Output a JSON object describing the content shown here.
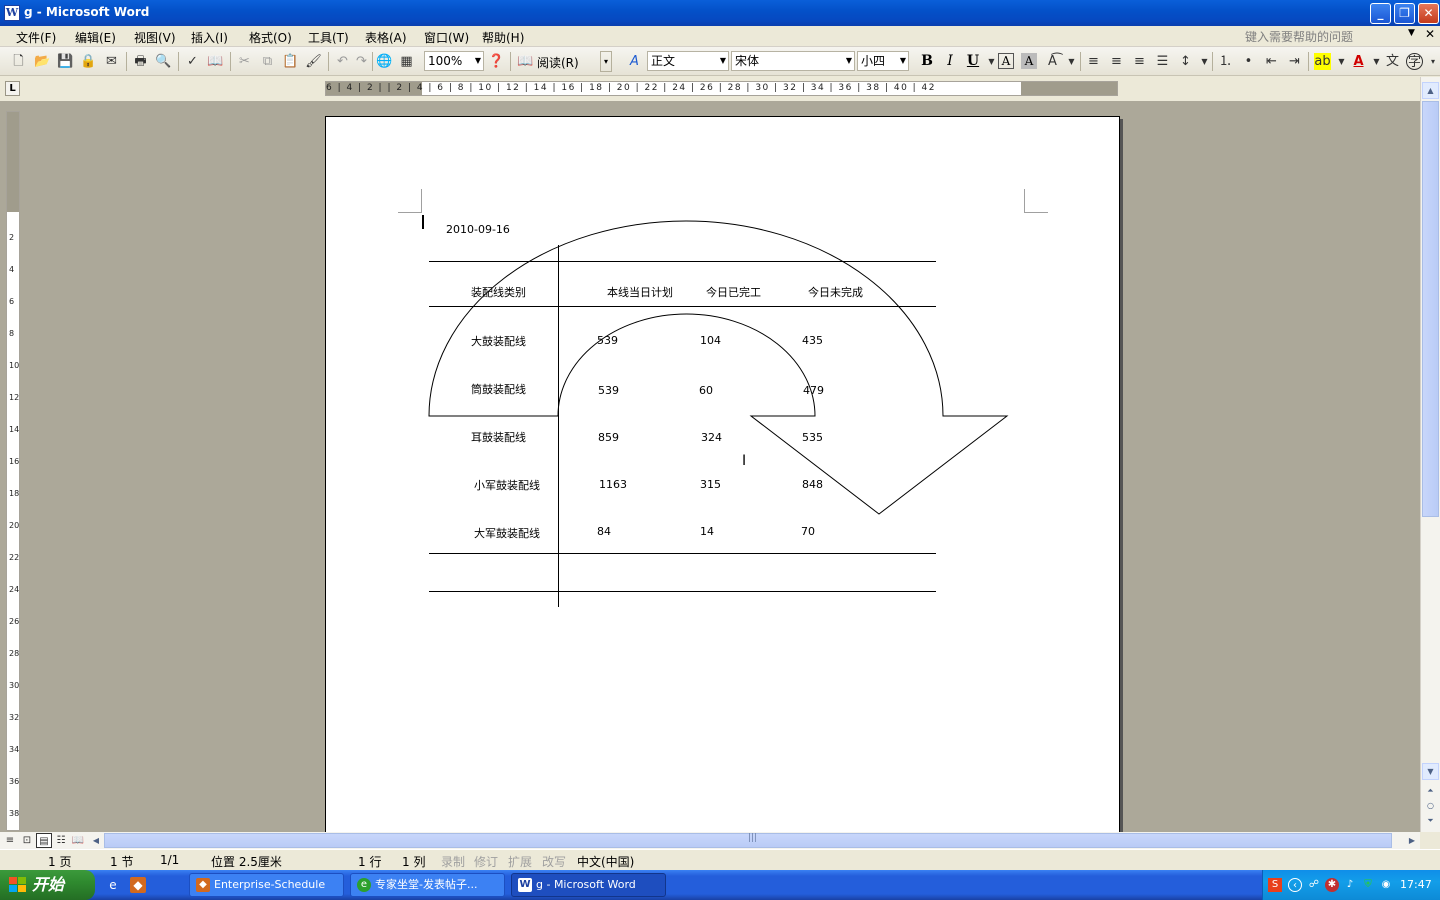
{
  "window": {
    "title": "g - Microsoft Word",
    "app_icon": "W"
  },
  "menu": {
    "items": [
      "文件(F)",
      "编辑(E)",
      "视图(V)",
      "插入(I)",
      "格式(O)",
      "工具(T)",
      "表格(A)",
      "窗口(W)",
      "帮助(H)"
    ],
    "help_placeholder": "键入需要帮助的问题"
  },
  "toolbar": {
    "zoom": "100%",
    "read_label": "阅读(R)",
    "style": "正文",
    "font": "宋体",
    "font_size": "小四",
    "bold": "B",
    "italic": "I",
    "underline": "U",
    "char_border": "A",
    "char_shading": "A"
  },
  "ruler": {
    "horizontal_ticks": "6 | 4 | 2 |   | 2 | 4 | 6 | 8 | 10 | 12 | 14 | 16 | 18 | 20 | 22 | 24 | 26 | 28 | 30 | 32 | 34 | 36 | 38 | 40 | 42",
    "vertical_ticks": [
      "2",
      "4",
      "6",
      "8",
      "10",
      "12",
      "14",
      "16",
      "18",
      "20",
      "22",
      "24",
      "26",
      "28",
      "30",
      "32",
      "34",
      "36",
      "38"
    ]
  },
  "document": {
    "date": "2010-09-16",
    "table": {
      "header_category": "装配线类别",
      "columns": [
        "本线当日计划",
        "今日已完工",
        "今日未完成"
      ],
      "rows": [
        {
          "name": "大鼓装配线",
          "plan": "539",
          "done": "104",
          "remaining": "435"
        },
        {
          "name": "筒鼓装配线",
          "plan": "539",
          "done": "60",
          "remaining": "479"
        },
        {
          "name": "耳鼓装配线",
          "plan": "859",
          "done": "324",
          "remaining": "535"
        },
        {
          "name": "小军鼓装配线",
          "plan": "1163",
          "done": "315",
          "remaining": "848"
        },
        {
          "name": "大军鼓装配线",
          "plan": "84",
          "done": "14",
          "remaining": "70"
        }
      ]
    }
  },
  "status": {
    "page": "1 页",
    "section": "1 节",
    "page_of": "1/1",
    "position": "位置 2.5厘米",
    "line": "1 行",
    "column": "1 列",
    "rec": "录制",
    "trk": "修订",
    "ext": "扩展",
    "ovr": "改写",
    "language": "中文(中国)"
  },
  "taskbar": {
    "start_label": "开始",
    "tasks": [
      "Enterprise-Schedule",
      "专家坐堂-发表帖子...",
      "g - Microsoft Word"
    ],
    "clock": "17:47"
  },
  "colors": {
    "title_bar": "#0a5fd9",
    "taskbar": "#245edb",
    "start_button": "#2f8a2f",
    "tray": "#139ee9",
    "doc_background": "#aca899"
  }
}
